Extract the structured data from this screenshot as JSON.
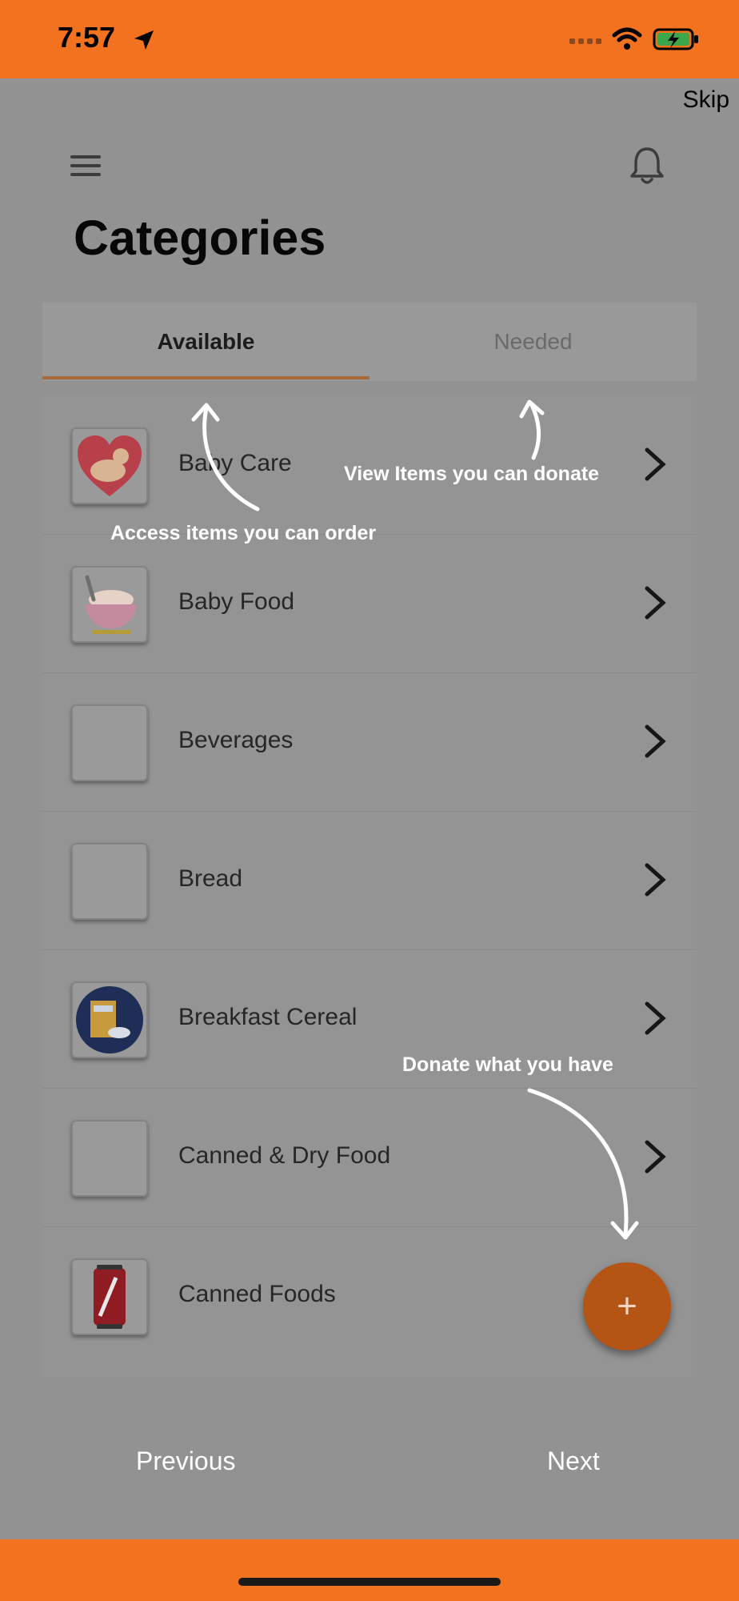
{
  "status_bar": {
    "time": "7:57"
  },
  "tutorial": {
    "skip_label": "Skip",
    "hints": {
      "access_order": "Access items you can order",
      "view_donate": "View Items you can donate",
      "donate_have": "Donate what you have"
    },
    "previous_label": "Previous",
    "next_label": "Next"
  },
  "header": {
    "menu_icon": "hamburger-icon",
    "bell_icon": "bell-icon"
  },
  "page": {
    "title": "Categories"
  },
  "tabs": [
    {
      "label": "Available",
      "active": true
    },
    {
      "label": "Needed",
      "active": false
    }
  ],
  "categories": [
    {
      "label": "Baby Care",
      "icon": "baby-care-heart-icon"
    },
    {
      "label": "Baby Food",
      "icon": "baby-food-bowl-icon"
    },
    {
      "label": "Beverages",
      "icon": ""
    },
    {
      "label": "Bread",
      "icon": ""
    },
    {
      "label": "Breakfast Cereal",
      "icon": "cereal-box-icon"
    },
    {
      "label": "Canned & Dry Food",
      "icon": ""
    },
    {
      "label": "Canned Foods",
      "icon": "soda-can-icon"
    }
  ],
  "fab": {
    "label": "+"
  },
  "colors": {
    "accent": "#F2721F",
    "overlay": "#929292",
    "fab": "#B45415",
    "tab_indicator": "#A86A3B"
  }
}
